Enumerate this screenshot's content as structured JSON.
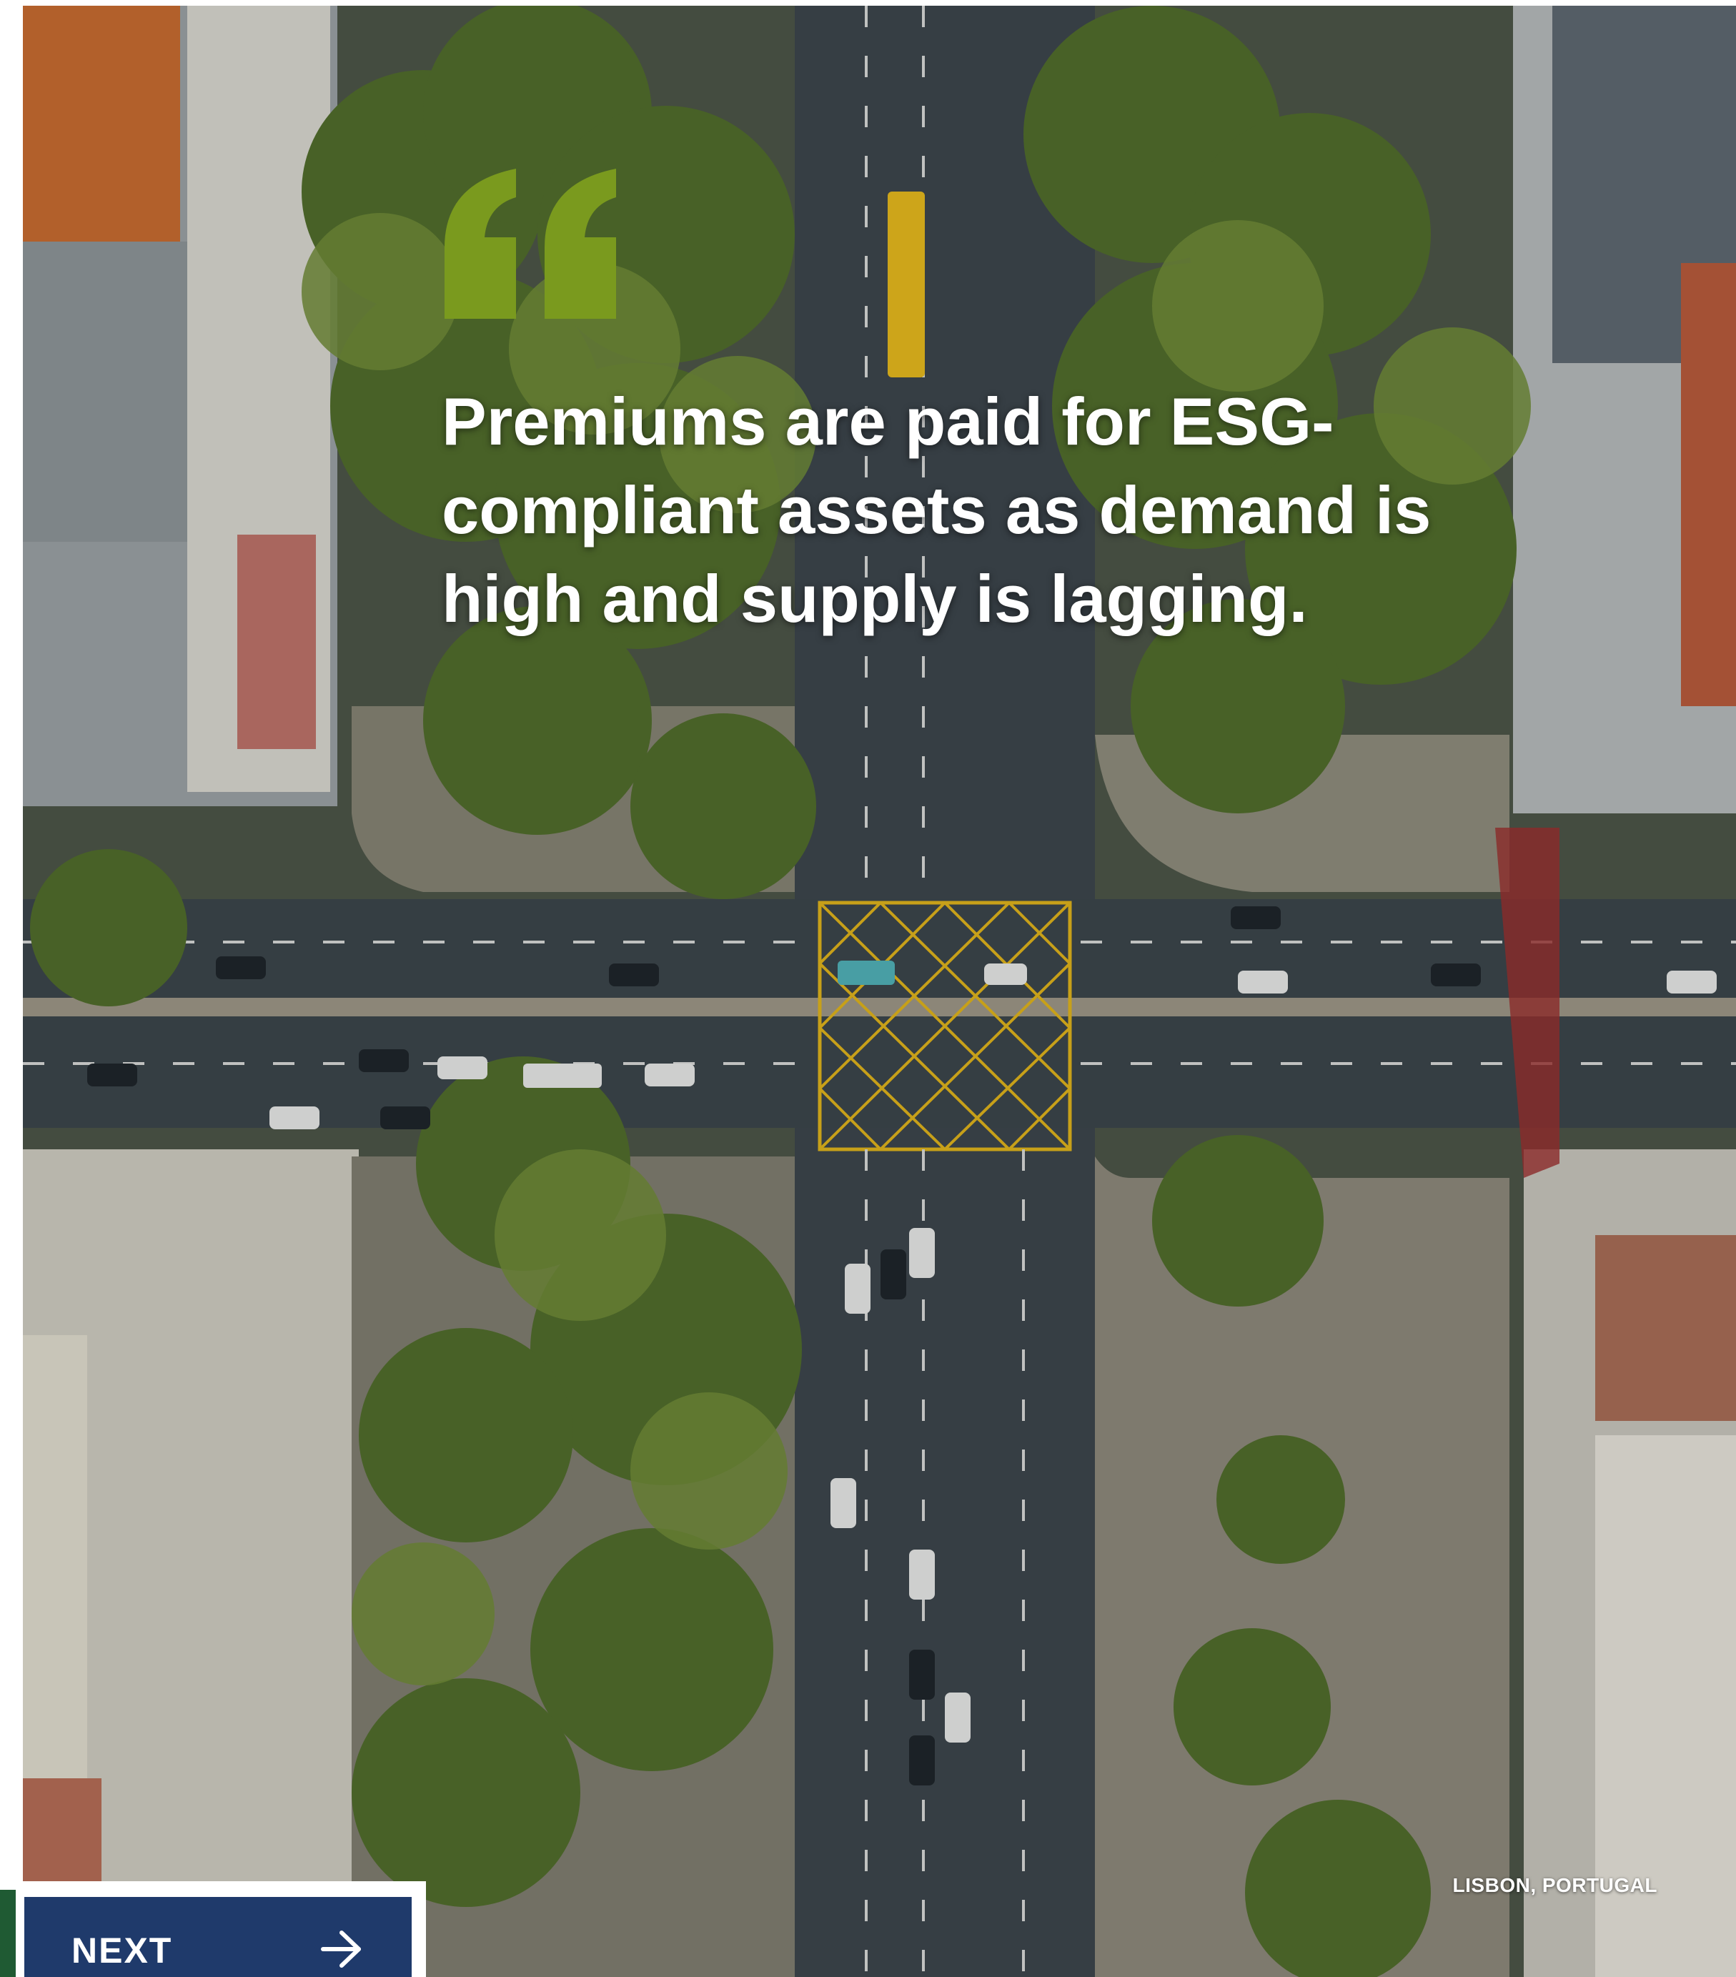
{
  "quote": {
    "mark_icon": "quote-open-icon",
    "text": "Premiums are paid for ESG-compliant assets as demand is high and supply is lagging."
  },
  "photo": {
    "caption": "LISBON, PORTUGAL"
  },
  "navigation": {
    "next_label": "NEXT",
    "next_icon": "arrow-right-icon"
  },
  "colors": {
    "accent_green": "#7a9a1e",
    "button_navy": "#1f3a6b",
    "strip_green": "#1f5a33"
  }
}
